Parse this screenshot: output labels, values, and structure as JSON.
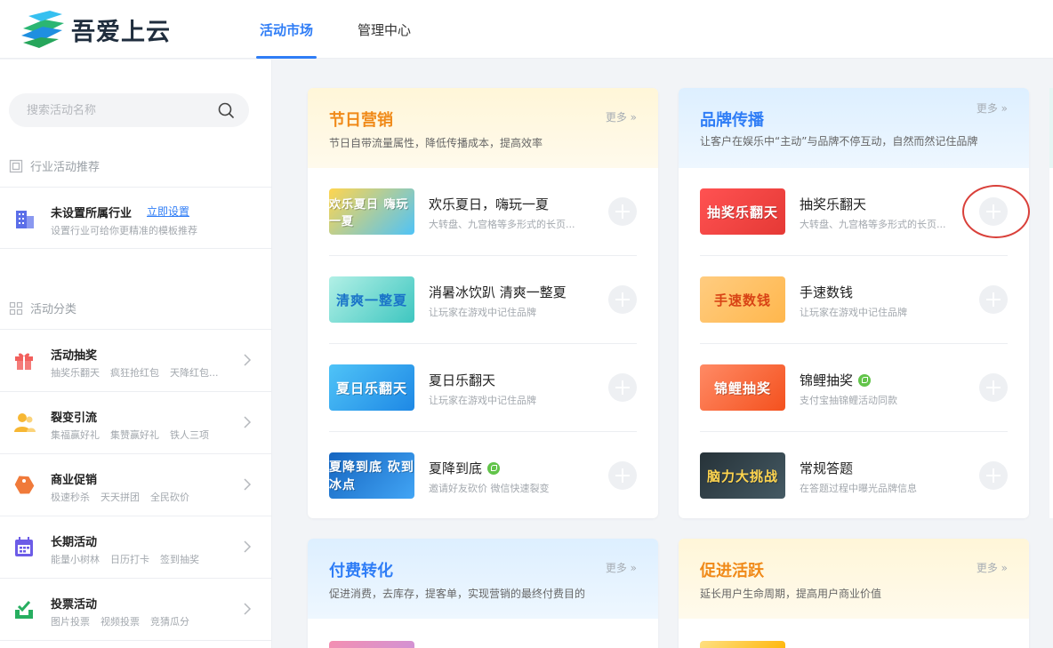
{
  "header": {
    "logo_text": "吾爱上云",
    "nav": [
      {
        "label": "活动市场",
        "active": true
      },
      {
        "label": "管理中心",
        "active": false
      }
    ]
  },
  "sidebar": {
    "search_placeholder": "搜索活动名称",
    "recommend_title": "行业活动推荐",
    "industry": {
      "title": "未设置所属行业",
      "link": "立即设置",
      "desc": "设置行业可给你更精准的模板推荐"
    },
    "category_title": "活动分类",
    "categories": [
      {
        "name": "活动抽奖",
        "subs": [
          "抽奖乐翻天",
          "疯狂抢红包",
          "天降红包..."
        ],
        "icon": "gift-icon",
        "color": "#f25f5c"
      },
      {
        "name": "裂变引流",
        "subs": [
          "集福赢好礼",
          "集赞赢好礼",
          "铁人三项"
        ],
        "icon": "users-icon",
        "color": "#f7b733"
      },
      {
        "name": "商业促销",
        "subs": [
          "极速秒杀",
          "天天拼团",
          "全民砍价"
        ],
        "icon": "tag-icon",
        "color": "#f07a3a"
      },
      {
        "name": "长期活动",
        "subs": [
          "能量小树林",
          "日历打卡",
          "签到抽奖"
        ],
        "icon": "calendar-icon",
        "color": "#6c5ce7"
      },
      {
        "name": "投票活动",
        "subs": [
          "图片投票",
          "视频投票",
          "竞猜瓜分"
        ],
        "icon": "vote-icon",
        "color": "#27ae60"
      }
    ]
  },
  "cards": [
    {
      "title": "节日营销",
      "more": "更多",
      "desc": "节日自带流量属性，降低传播成本，提高效率",
      "items": [
        {
          "name": "欢乐夏日，嗨玩一夏",
          "desc": "大转盘、九宫格等多形式的长页...",
          "thumb_text": "欢乐夏日 嗨玩一夏",
          "badge": false
        },
        {
          "name": "消暑冰饮趴 清爽一整夏",
          "desc": "让玩家在游戏中记住品牌",
          "thumb_text": "清爽一整夏",
          "badge": false
        },
        {
          "name": "夏日乐翻天",
          "desc": "让玩家在游戏中记住品牌",
          "thumb_text": "夏日乐翻天",
          "badge": false
        },
        {
          "name": "夏降到底",
          "desc": "邀请好友砍价 微信快速裂变",
          "thumb_text": "夏降到底 砍到冰点",
          "badge": true
        }
      ]
    },
    {
      "title": "品牌传播",
      "more": "更多",
      "desc": "让客户在娱乐中“主动”与品牌不停互动，自然而然记住品牌",
      "items": [
        {
          "name": "抽奖乐翻天",
          "desc": "大转盘、九宫格等多形式的长页...",
          "thumb_text": "抽奖乐翻天",
          "badge": false
        },
        {
          "name": "手速数钱",
          "desc": "让玩家在游戏中记住品牌",
          "thumb_text": "手速数钱",
          "badge": false
        },
        {
          "name": "锦鲤抽奖",
          "desc": "支付宝抽锦鲤活动同款",
          "thumb_text": "锦鲤抽奖",
          "badge": true
        },
        {
          "name": "常规答题",
          "desc": "在答题过程中曝光品牌信息",
          "thumb_text": "脑力大挑战",
          "badge": false
        }
      ]
    },
    {
      "title": "付费转化",
      "more": "更多",
      "desc": "促进消费，去库存，提客单，实现营销的最终付费目的"
    },
    {
      "title": "促进活跃",
      "more": "更多",
      "desc": "延长用户生命周期，提高用户商业价值"
    }
  ],
  "colors": {
    "accent": "#2f7df6",
    "orange_title": "#f08a19",
    "highlight": "#d9403a"
  }
}
